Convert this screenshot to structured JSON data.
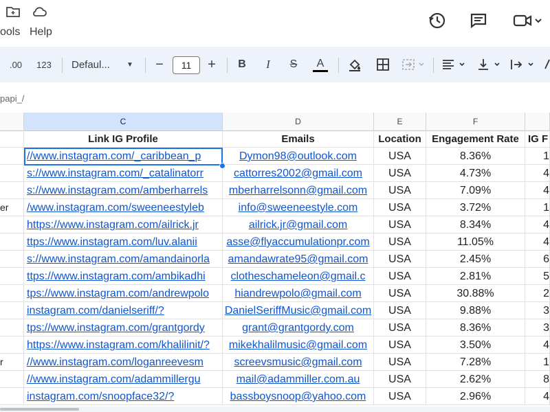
{
  "menu": {
    "items": [
      "ools",
      "Help"
    ]
  },
  "toolbar": {
    "decimal_increase": ".00",
    "format_123": "123",
    "font_name": "Defaul...",
    "font_size": "11",
    "minus": "−",
    "plus": "+",
    "bold": "B",
    "italic": "I",
    "strike": "S",
    "text_color_letter": "A",
    "accent_color": "#1a73e8"
  },
  "formula_bar": {
    "text": "papi_/"
  },
  "columns": {
    "c": "C",
    "d": "D",
    "e": "E",
    "f": "F"
  },
  "headers": {
    "link": "Link IG Profile",
    "emails": "Emails",
    "location": "Location",
    "engagement": "Engagement Rate",
    "ig_followers": "IG F"
  },
  "rows": [
    {
      "frag": "",
      "link": "//www.instagram.com/_caribbean_p",
      "email": "Dymon98@outlook.com",
      "location": "USA",
      "rate": "8.36%",
      "ig": "1"
    },
    {
      "frag": "",
      "link": "s://www.instagram.com/_catalinatorr",
      "email": "cattorres2002@gmail.com",
      "location": "USA",
      "rate": "4.73%",
      "ig": "4"
    },
    {
      "frag": "",
      "link": "s://www.instagram.com/amberharrels",
      "email": "mberharrelsonn@gmail.com",
      "location": "USA",
      "rate": "7.09%",
      "ig": "4"
    },
    {
      "frag": "er",
      "link": "/www.instagram.com/sweeneestyleb",
      "email": "info@sweeneestyle.com",
      "location": "USA",
      "rate": "3.72%",
      "ig": "1"
    },
    {
      "frag": "",
      "link": "https://www.instagram.com/ailrick.jr",
      "email": "ailrick.jr@gmail.com",
      "location": "USA",
      "rate": "8.34%",
      "ig": "4"
    },
    {
      "frag": "",
      "link": "ttps://www.instagram.com/luv.alanii",
      "email": "asse@flyaccumulationpr.com",
      "location": "USA",
      "rate": "11.05%",
      "ig": "4"
    },
    {
      "frag": "",
      "link": "s://www.instagram.com/amandainorla",
      "email": "amandawrate95@gmail.com",
      "location": "USA",
      "rate": "2.45%",
      "ig": "6"
    },
    {
      "frag": "",
      "link": "ttps://www.instagram.com/ambikadhi",
      "email": "clotheschameleon@gmail.c",
      "location": "USA",
      "rate": "2.81%",
      "ig": "5"
    },
    {
      "frag": "",
      "link": "tps://www.instagram.com/andrewpolo",
      "email": "hiandrewpolo@gmail.com",
      "location": "USA",
      "rate": "30.88%",
      "ig": "2"
    },
    {
      "frag": "",
      "link": "instagram.com/danielseriff/?",
      "email": "DanielSeriffMusic@gmail.com",
      "location": "USA",
      "rate": "9.88%",
      "ig": "3"
    },
    {
      "frag": "",
      "link": "tps://www.instagram.com/grantgordy",
      "email": "grant@grantgordy.com",
      "location": "USA",
      "rate": "8.36%",
      "ig": "3"
    },
    {
      "frag": "",
      "link": "https://www.instagram.com/khalilinit/?",
      "email": "mikekhalilmusic@gmail.com",
      "location": "USA",
      "rate": "3.50%",
      "ig": "4"
    },
    {
      "frag": "r",
      "link": "//www.instagram.com/loganreevesm",
      "email": "screevsmusic@gmail.com",
      "location": "USA",
      "rate": "7.28%",
      "ig": "1"
    },
    {
      "frag": "",
      "link": "//www.instagram.com/adammillergu",
      "email": "mail@adammiller.com.au",
      "location": "USA",
      "rate": "2.62%",
      "ig": "8"
    },
    {
      "frag": "",
      "link": "instagram.com/snoopface32/?",
      "email": "bassboysnoop@yahoo.com",
      "location": "USA",
      "rate": "2.96%",
      "ig": "4"
    }
  ]
}
